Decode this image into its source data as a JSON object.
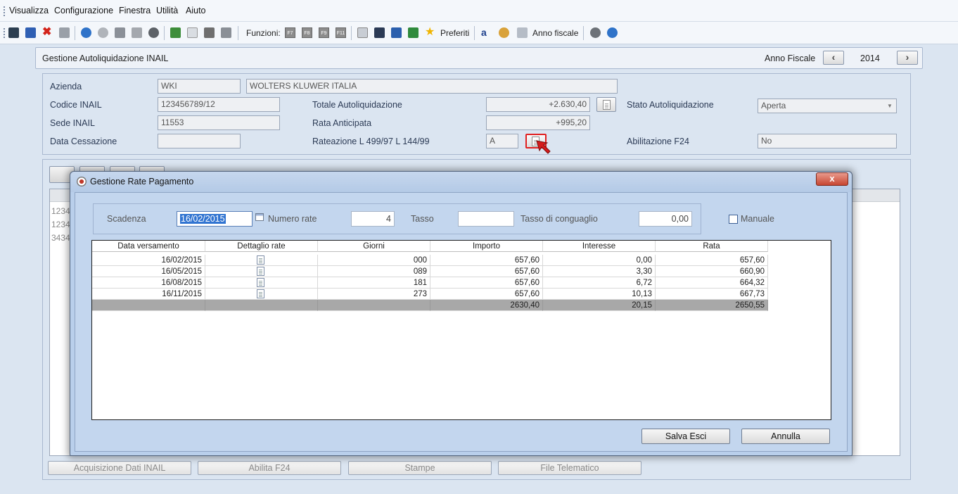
{
  "menu": {
    "items": [
      "Visualizza",
      "Configurazione",
      "Finestra",
      "Utilità",
      "Aiuto"
    ]
  },
  "toolbar": {
    "functions_label": "Funzioni:",
    "fkeys": [
      "F7",
      "F8",
      "F9",
      "F11"
    ],
    "favorites_label": "Preferiti",
    "fiscal_year_label": "Anno fiscale"
  },
  "header": {
    "title": "Gestione Autoliquidazione INAIL",
    "year_label": "Anno Fiscale",
    "year_value": "2014",
    "prev": "‹",
    "next": "›"
  },
  "form": {
    "azienda_label": "Azienda",
    "azienda_code": "WKI",
    "azienda_name": "WOLTERS KLUWER ITALIA",
    "codice_label": "Codice INAIL",
    "codice_value": "123456789/12",
    "sede_label": "Sede INAIL",
    "sede_value": "11553",
    "cessazione_label": "Data Cessazione",
    "cessazione_value": "",
    "totale_label": "Totale Autoliquidazione",
    "totale_value": "+2.630,40",
    "rata_ant_label": "Rata Anticipata",
    "rata_ant_value": "+995,20",
    "rateazione_label": "Rateazione L 499/97 L 144/99",
    "rateazione_value": "A",
    "stato_label": "Stato Autoliquidazione",
    "stato_value": "Aperta",
    "f24_label": "Abilitazione F24",
    "f24_value": "No"
  },
  "background_list": {
    "rows": [
      "1234",
      "1234",
      "3434"
    ]
  },
  "bottom_buttons": [
    "Acquisizione Dati INAIL",
    "Abilita F24",
    "Stampe",
    "File Telematico"
  ],
  "dialog": {
    "title": "Gestione Rate Pagamento",
    "close": "x",
    "scadenza_label": "Scadenza",
    "scadenza_value": "16/02/2015",
    "numero_rate_label": "Numero rate",
    "numero_rate_value": "4",
    "tasso_label": "Tasso",
    "tasso_value": "",
    "conguaglio_label": "Tasso di conguaglio",
    "conguaglio_value": "0,00",
    "manuale_label": "Manuale",
    "columns": [
      "Data versamento",
      "Dettaglio rate",
      "Giorni",
      "Importo",
      "Interesse",
      "Rata"
    ],
    "rows": [
      [
        "16/02/2015",
        "",
        "000",
        "657,60",
        "0,00",
        "657,60"
      ],
      [
        "16/05/2015",
        "",
        "089",
        "657,60",
        "3,30",
        "660,90"
      ],
      [
        "16/08/2015",
        "",
        "181",
        "657,60",
        "6,72",
        "664,32"
      ],
      [
        "16/11/2015",
        "",
        "273",
        "657,60",
        "10,13",
        "667,73"
      ]
    ],
    "totals": [
      "",
      "",
      "",
      "2630,40",
      "20,15",
      "2650,55"
    ],
    "save_label": "Salva Esci",
    "cancel_label": "Annulla"
  },
  "colors": {
    "background": "#dbe5f1",
    "dialog": "#b9cfeb",
    "close_button": "#c74631",
    "highlight": "#e02020"
  }
}
